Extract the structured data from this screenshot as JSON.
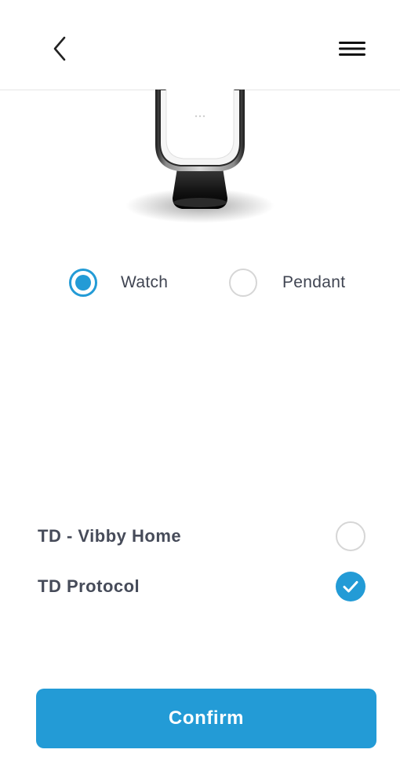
{
  "header": {
    "back_icon": "chevron-left-icon",
    "menu_icon": "hamburger-menu-icon"
  },
  "device": {
    "image": "watch-device-image"
  },
  "device_type": {
    "options": [
      {
        "label": "Watch",
        "selected": true
      },
      {
        "label": "Pendant",
        "selected": false
      }
    ]
  },
  "protocols": {
    "items": [
      {
        "label": "TD - Vibby Home",
        "checked": false
      },
      {
        "label": "TD Protocol",
        "checked": true
      }
    ]
  },
  "actions": {
    "confirm_label": "Confirm"
  },
  "colors": {
    "accent": "#239bd6",
    "text": "#464b59",
    "unselected": "#d6d6d6"
  }
}
